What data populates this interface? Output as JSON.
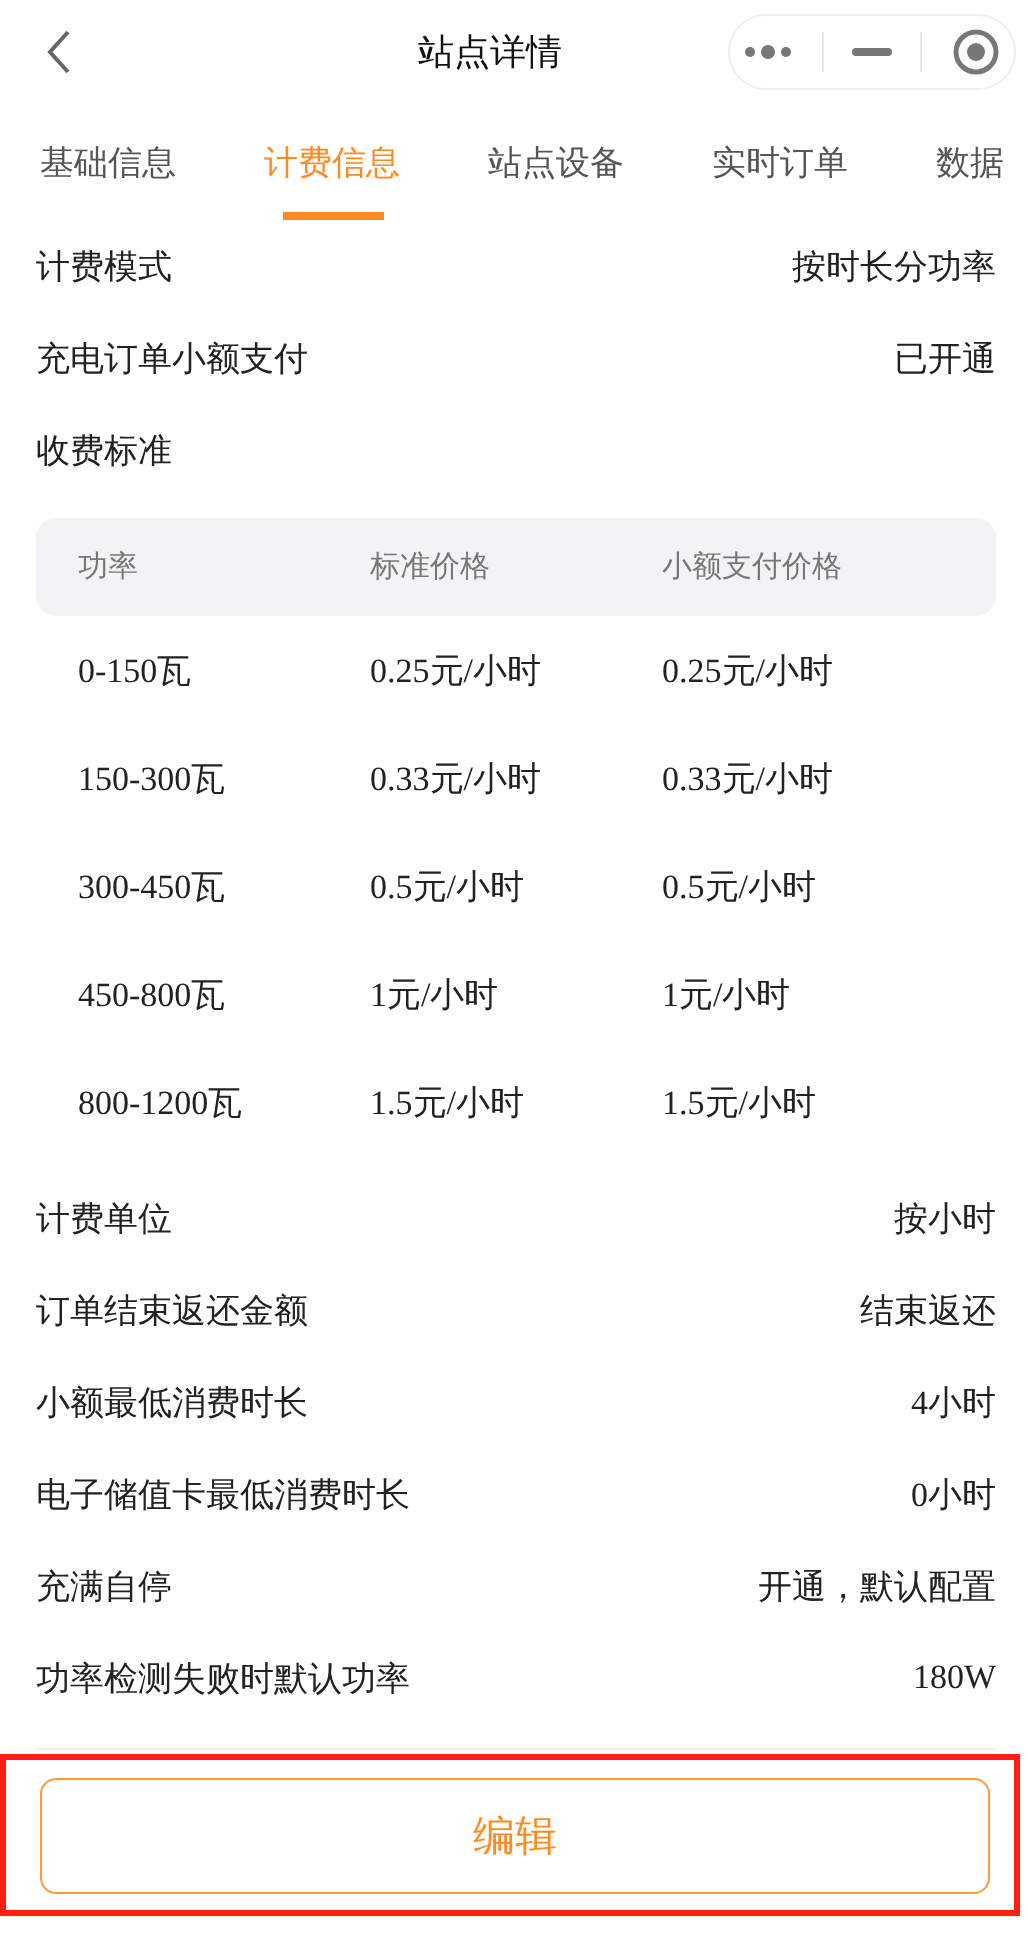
{
  "nav": {
    "title": "站点详情"
  },
  "tabs": [
    {
      "label": "基础信息",
      "selected": false
    },
    {
      "label": "计费信息",
      "selected": true
    },
    {
      "label": "站点设备",
      "selected": false
    },
    {
      "label": "实时订单",
      "selected": false
    },
    {
      "label": "数据",
      "selected": false
    }
  ],
  "top_rows": [
    {
      "label": "计费模式",
      "value": "按时长分功率"
    },
    {
      "label": "充电订单小额支付",
      "value": "已开通"
    },
    {
      "label": "收费标准"
    }
  ],
  "price_table": {
    "columns": [
      "功率",
      "标准价格",
      "小额支付价格"
    ],
    "rows": [
      [
        "0-150瓦",
        "0.25元/小时",
        "0.25元/小时"
      ],
      [
        "150-300瓦",
        "0.33元/小时",
        "0.33元/小时"
      ],
      [
        "300-450瓦",
        "0.5元/小时",
        "0.5元/小时"
      ],
      [
        "450-800瓦",
        "1元/小时",
        "1元/小时"
      ],
      [
        "800-1200瓦",
        "1.5元/小时",
        "1.5元/小时"
      ]
    ]
  },
  "bottom_rows": [
    {
      "label": "计费单位",
      "value": "按小时"
    },
    {
      "label": "订单结束返还金额",
      "value": "结束返还"
    },
    {
      "label": "小额最低消费时长",
      "value": "4小时"
    },
    {
      "label": "电子储值卡最低消费时长",
      "value": "0小时"
    },
    {
      "label": "充满自停",
      "value": "开通，默认配置"
    },
    {
      "label": "功率检测失败时默认功率",
      "value": "180W"
    }
  ],
  "footer": {
    "highlighted": true,
    "button": "编辑"
  }
}
